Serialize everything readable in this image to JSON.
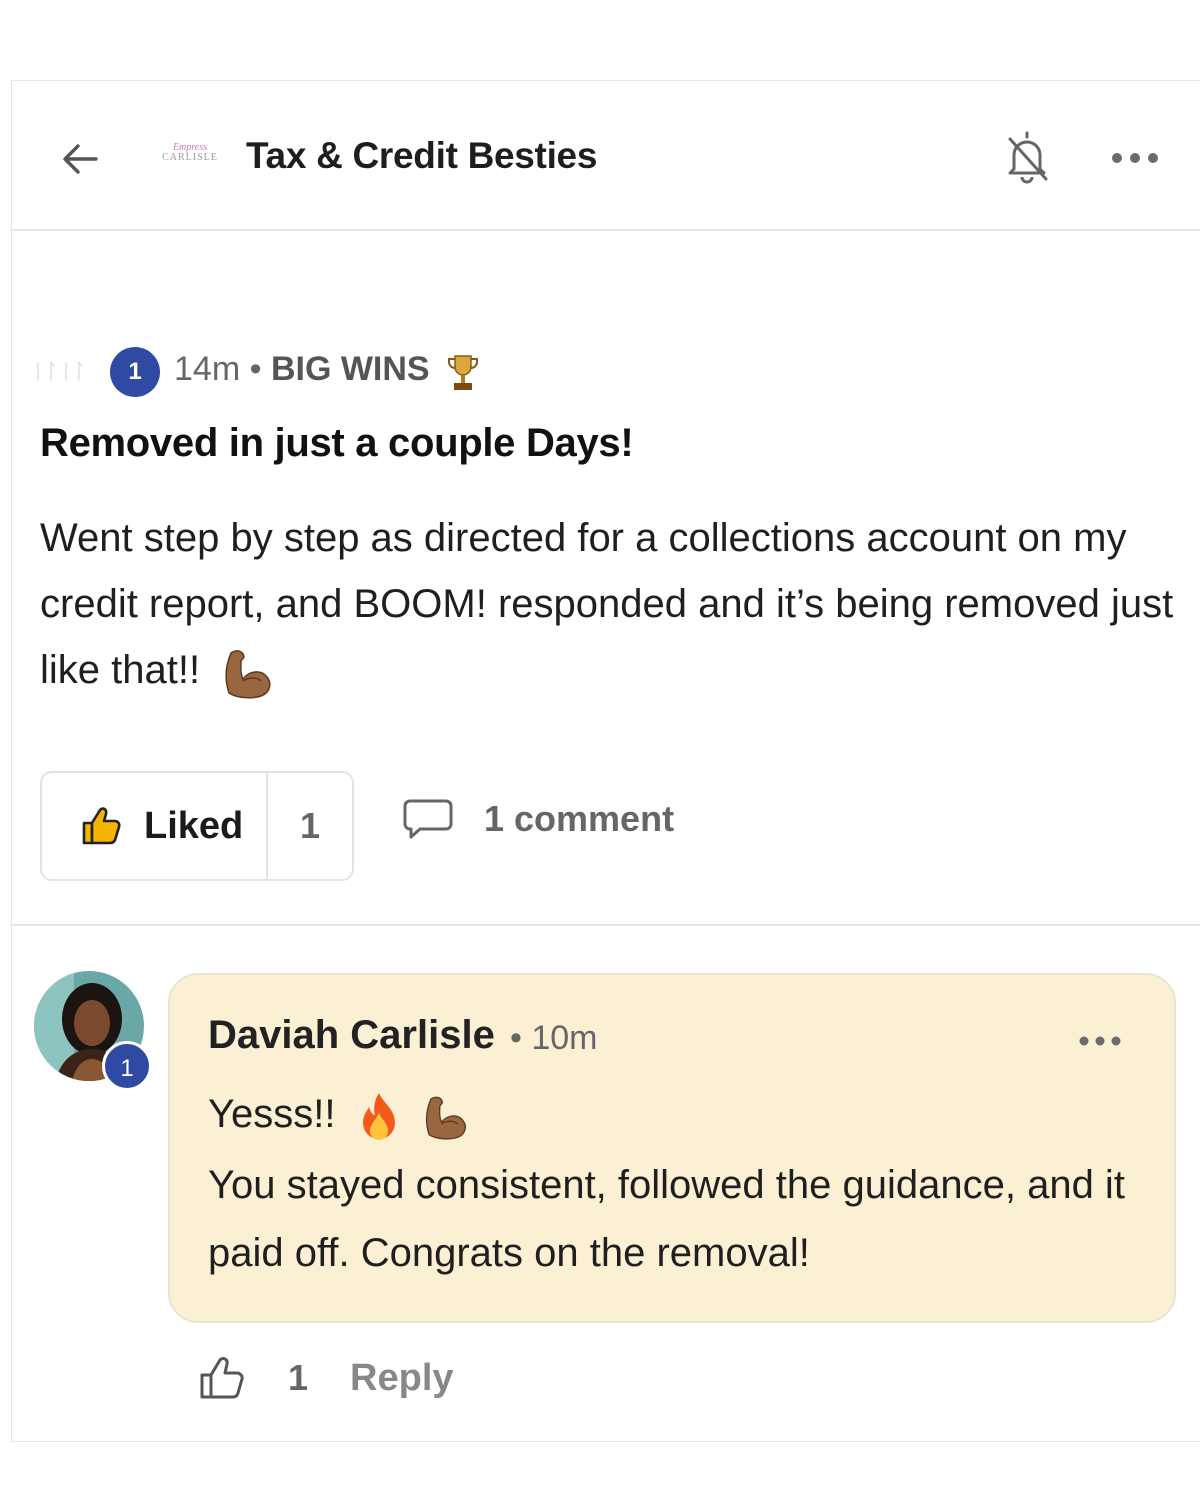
{
  "header": {
    "title": "Tax & Credit Besties",
    "logo_line1": "Empress",
    "logo_line2": "CARLISLE",
    "icons": [
      "back-arrow-icon",
      "bell-off-icon",
      "more-horizontal-icon"
    ]
  },
  "post": {
    "faded_text": "ᛁᛚᛁᛚ",
    "author_level": "1",
    "time": "14m",
    "separator": "•",
    "category": "BIG WINS",
    "category_icon": "trophy-icon",
    "title": "Removed in just a couple Days!",
    "body": "Went step by step as directed for a collections account on my credit report, and BOOM! responded and it’s being removed just like that!!",
    "body_emoji": "flexed-biceps-icon",
    "like_label": "Liked",
    "like_count": "1",
    "comment_label": "1 comment"
  },
  "comment": {
    "author": "Daviah Carlisle",
    "separator": "•",
    "time": "10m",
    "author_level": "1",
    "line1": "Yesss!!",
    "line1_emojis": [
      "fire-icon",
      "flexed-biceps-icon"
    ],
    "line2": "You stayed consistent, followed the guidance, and it paid off. Congrats on the removal!",
    "like_count": "1",
    "reply_label": "Reply",
    "bubble_color": "#fcf0d4"
  },
  "colors": {
    "badge_blue": "#2f4aa3",
    "muted_text": "#666666",
    "divider": "#e5e5e5"
  }
}
